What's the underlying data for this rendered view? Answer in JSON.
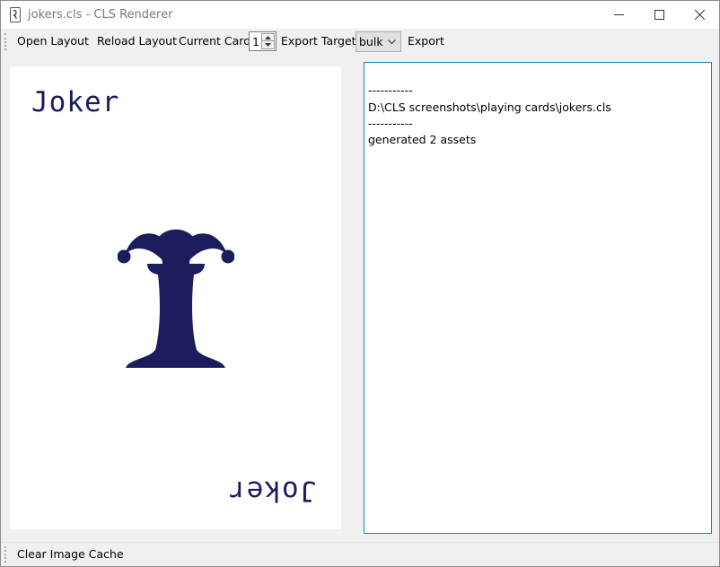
{
  "window": {
    "title": "jokers.cls - CLS Renderer"
  },
  "toolbar": {
    "open_layout": "Open Layout",
    "reload_layout": "Reload Layout",
    "current_card_label": "Current Card",
    "current_card_value": "1",
    "export_target_label": "Export Target",
    "export_target_value": "bulk",
    "export": "Export"
  },
  "card": {
    "top_label": "Joker",
    "bottom_label": "Joker",
    "ink_color": "#1b1c5c"
  },
  "log": {
    "lines": [
      "-----------",
      "D:\\CLS screenshots\\playing cards\\jokers.cls",
      "-----------",
      "generated 2 assets"
    ]
  },
  "statusbar": {
    "clear_cache": "Clear Image Cache"
  }
}
